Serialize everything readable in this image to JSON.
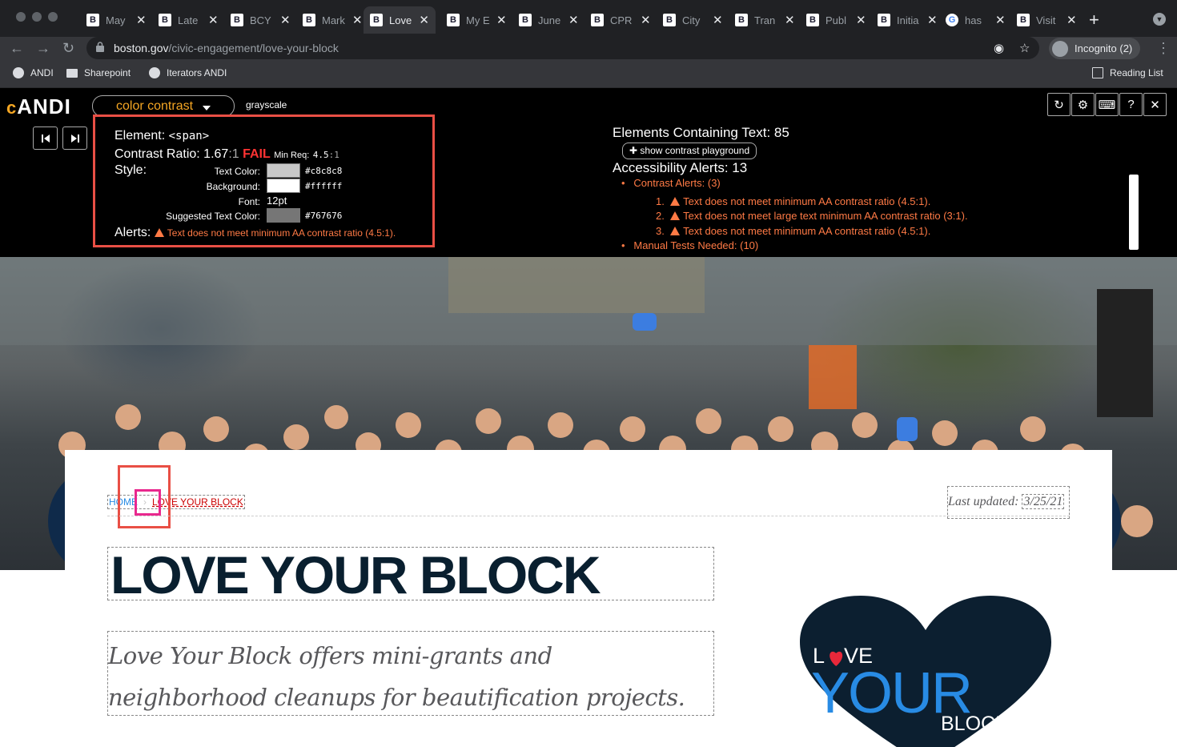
{
  "browser": {
    "tabs": [
      {
        "label": "May",
        "favicon": "B"
      },
      {
        "label": "Late",
        "favicon": "B"
      },
      {
        "label": "BCY",
        "favicon": "B"
      },
      {
        "label": "Mark",
        "favicon": "B"
      },
      {
        "label": "Love",
        "favicon": "B",
        "active": true
      },
      {
        "label": "My E",
        "favicon": "B"
      },
      {
        "label": "June",
        "favicon": "B"
      },
      {
        "label": "CPR",
        "favicon": "B"
      },
      {
        "label": "City",
        "favicon": "B"
      },
      {
        "label": "Tran",
        "favicon": "B"
      },
      {
        "label": "Publ",
        "favicon": "B"
      },
      {
        "label": "Initia",
        "favicon": "B"
      },
      {
        "label": "has",
        "favicon": "G"
      },
      {
        "label": "Visit",
        "favicon": "B"
      }
    ],
    "url_domain": "boston.gov",
    "url_path": "/civic-engagement/love-your-block",
    "profile_label": "Incognito (2)",
    "bookmarks": [
      "ANDI",
      "Sharepoint",
      "Iterators ANDI"
    ],
    "reading_list": "Reading List"
  },
  "andi": {
    "logo_c": "c",
    "logo_text": "ANDI",
    "module": "color contrast",
    "grayscale": "grayscale",
    "element_label": "Element:",
    "element_value": "<span>",
    "ratio_label": "Contrast Ratio:",
    "ratio_value": "1.67",
    "ratio_suffix": ":1",
    "fail": "FAIL",
    "minreq_label": "Min Req:",
    "minreq_value": "4.5",
    "minreq_suffix": ":1",
    "style_label": "Style:",
    "text_color_label": "Text Color:",
    "text_color": "#c8c8c8",
    "background_label": "Background:",
    "background": "#ffffff",
    "font_label": "Font:",
    "font_value": "12pt",
    "suggested_label": "Suggested Text Color:",
    "suggested_color": "#767676",
    "alerts_label": "Alerts:",
    "alert_text": "Text does not meet minimum AA contrast ratio (4.5:1).",
    "elements_text": "Elements Containing Text: 85",
    "playground": "show contrast playground",
    "accessibility_alerts": "Accessibility Alerts: 13",
    "contrast_alerts": "Contrast Alerts: (3)",
    "alert_list": [
      "Text does not meet minimum AA contrast ratio (4.5:1).",
      "Text does not meet large text minimum AA contrast ratio (3:1).",
      "Text does not meet minimum AA contrast ratio (4.5:1)."
    ],
    "manual_tests": "Manual Tests Needed: (10)"
  },
  "page": {
    "breadcrumb_home": "HOME",
    "breadcrumb_sep": "›",
    "breadcrumb_current": "LOVE YOUR BLOCK",
    "updated_label": "Last updated:",
    "updated_date": "3/25/21",
    "title": "LOVE YOUR BLOCK",
    "intro": "Love Your Block offers mini-grants and neighborhood cleanups for beautification projects.",
    "logo_l": "L",
    "logo_ve": "VE",
    "logo_your": "YOUR",
    "logo_block": "BLOCK"
  },
  "colors": {
    "andi_orange": "#f5a623",
    "alert_orange": "#ff7a45",
    "fail_red": "#ff3333",
    "highlight_red": "#e94f45",
    "highlight_pink": "#e9288e",
    "boston_navy": "#091f2f",
    "boston_blue": "#288be4",
    "logo_heart_red": "#e8283a"
  }
}
